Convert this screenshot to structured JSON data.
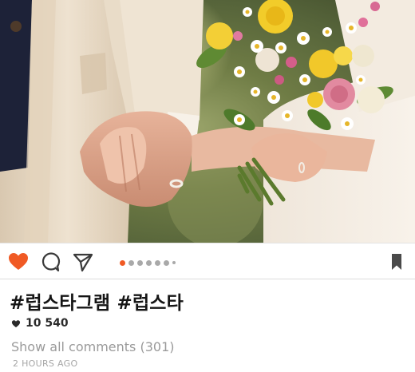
{
  "post": {
    "photo": {
      "subject": "wedding-hands-bouquet"
    },
    "actions": {
      "like_icon": "heart-icon",
      "comment_icon": "comment-icon",
      "share_icon": "send-icon",
      "save_icon": "bookmark-icon",
      "like_color": "#f05a24",
      "carousel": {
        "dots": 7,
        "active_index": 0
      }
    },
    "caption": "#럽스타그램 #럽스타",
    "likes": {
      "icon": "heart-small-icon",
      "count": "10 540"
    },
    "comments_link": "Show all comments (301)",
    "timestamp": "2 HOURS AGO"
  }
}
